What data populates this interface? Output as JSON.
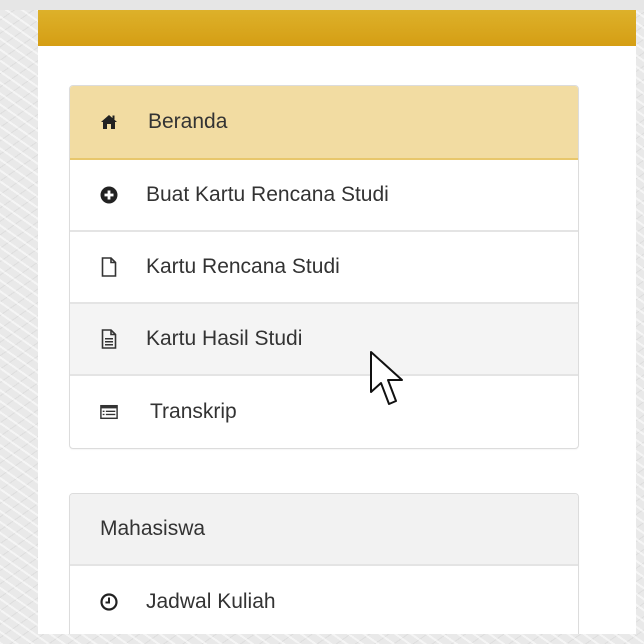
{
  "menu": {
    "items": [
      {
        "label": "Beranda",
        "icon": "home-icon"
      },
      {
        "label": "Buat Kartu Rencana Studi",
        "icon": "plus-circle-icon"
      },
      {
        "label": "Kartu Rencana Studi",
        "icon": "file-icon"
      },
      {
        "label": "Kartu Hasil Studi",
        "icon": "file-text-icon"
      },
      {
        "label": "Transkrip",
        "icon": "list-icon"
      }
    ],
    "active_index": 0
  },
  "mahasiswa": {
    "heading": "Mahasiswa",
    "items": [
      {
        "label": "Jadwal Kuliah",
        "icon": "clock-icon"
      }
    ]
  },
  "colors": {
    "header": "#d9a51e",
    "active_bg": "#f2dca2",
    "text": "#333333"
  }
}
